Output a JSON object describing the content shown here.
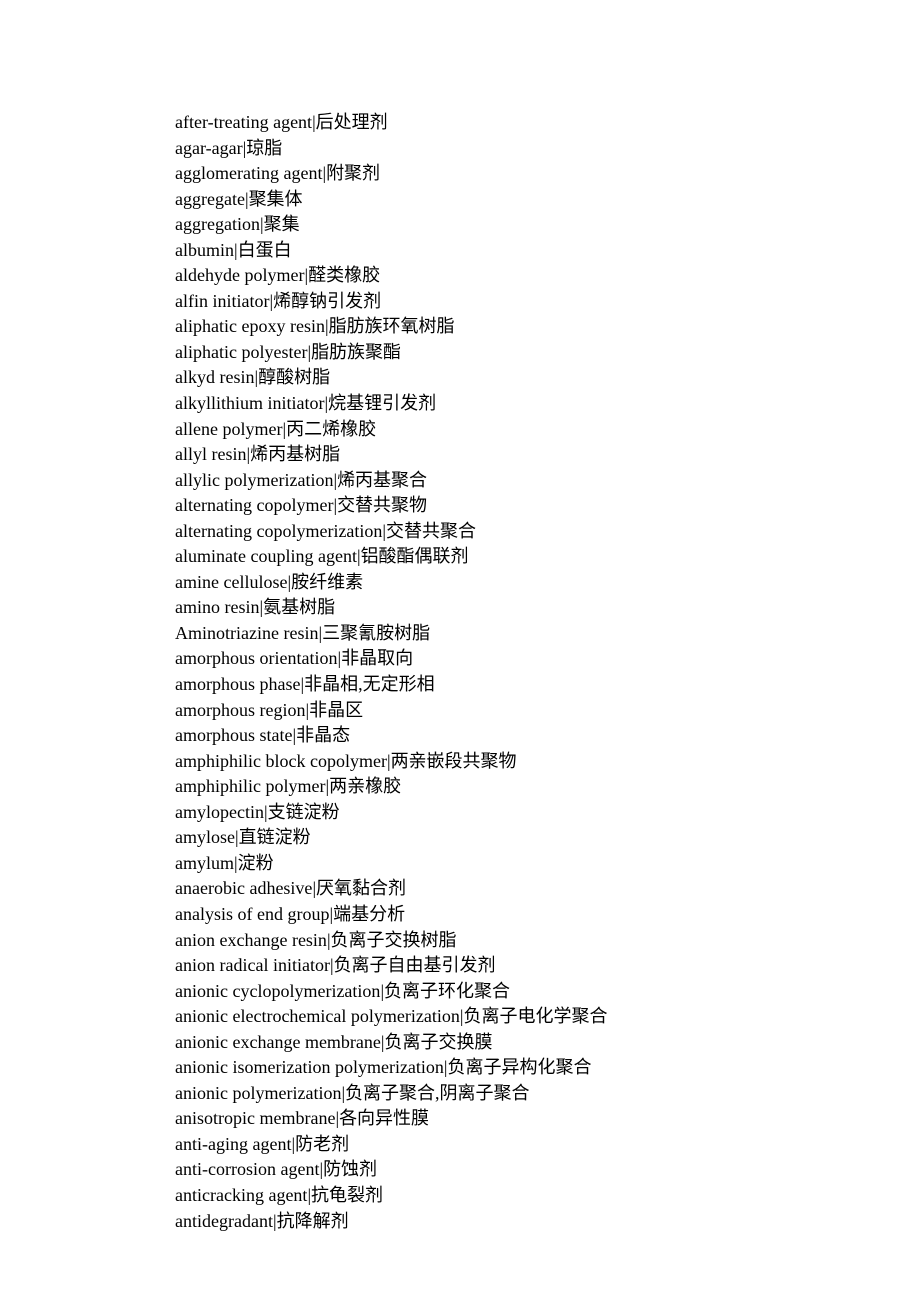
{
  "terms": [
    {
      "en": "after-treating agent",
      "zh": "后处理剂"
    },
    {
      "en": "agar-agar",
      "zh": "琼脂"
    },
    {
      "en": "agglomerating agent",
      "zh": "附聚剂"
    },
    {
      "en": "aggregate",
      "zh": "聚集体"
    },
    {
      "en": "aggregation",
      "zh": "聚集"
    },
    {
      "en": "albumin",
      "zh": "白蛋白"
    },
    {
      "en": "aldehyde polymer",
      "zh": "醛类橡胶"
    },
    {
      "en": "alfin initiator",
      "zh": "烯醇钠引发剂"
    },
    {
      "en": "aliphatic epoxy resin",
      "zh": "脂肪族环氧树脂"
    },
    {
      "en": "aliphatic polyester",
      "zh": "脂肪族聚酯"
    },
    {
      "en": "alkyd resin",
      "zh": "醇酸树脂"
    },
    {
      "en": "alkyllithium initiator",
      "zh": "烷基锂引发剂"
    },
    {
      "en": "allene polymer",
      "zh": "丙二烯橡胶"
    },
    {
      "en": "allyl resin",
      "zh": "烯丙基树脂"
    },
    {
      "en": "allylic polymerization",
      "zh": "烯丙基聚合"
    },
    {
      "en": "alternating copolymer",
      "zh": "交替共聚物"
    },
    {
      "en": "alternating copolymerization",
      "zh": "交替共聚合"
    },
    {
      "en": "aluminate coupling agent",
      "zh": "铝酸酯偶联剂"
    },
    {
      "en": "amine cellulose",
      "zh": "胺纤维素"
    },
    {
      "en": "amino resin",
      "zh": "氨基树脂"
    },
    {
      "en": "Aminotriazine resin",
      "zh": "三聚氰胺树脂"
    },
    {
      "en": "amorphous orientation",
      "zh": "非晶取向"
    },
    {
      "en": "amorphous phase",
      "zh": "非晶相,无定形相"
    },
    {
      "en": "amorphous region",
      "zh": "非晶区"
    },
    {
      "en": "amorphous state",
      "zh": "非晶态"
    },
    {
      "en": "amphiphilic block copolymer",
      "zh": "两亲嵌段共聚物"
    },
    {
      "en": "amphiphilic polymer",
      "zh": "两亲橡胶"
    },
    {
      "en": "amylopectin",
      "zh": "支链淀粉"
    },
    {
      "en": "amylose",
      "zh": "直链淀粉"
    },
    {
      "en": "amylum",
      "zh": "淀粉"
    },
    {
      "en": "anaerobic adhesive",
      "zh": "厌氧黏合剂"
    },
    {
      "en": "analysis of end group",
      "zh": "端基分析"
    },
    {
      "en": "anion exchange resin",
      "zh": "负离子交换树脂"
    },
    {
      "en": "anion radical initiator",
      "zh": "负离子自由基引发剂"
    },
    {
      "en": "anionic cyclopolymerization",
      "zh": "负离子环化聚合"
    },
    {
      "en": "anionic electrochemical polymerization",
      "zh": "负离子电化学聚合"
    },
    {
      "en": "anionic exchange membrane",
      "zh": "负离子交换膜"
    },
    {
      "en": "anionic isomerization polymerization",
      "zh": "负离子异构化聚合"
    },
    {
      "en": "anionic polymerization",
      "zh": "负离子聚合,阴离子聚合"
    },
    {
      "en": "anisotropic membrane",
      "zh": "各向异性膜"
    },
    {
      "en": "anti-aging agent",
      "zh": "防老剂"
    },
    {
      "en": "anti-corrosion agent",
      "zh": "防蚀剂"
    },
    {
      "en": "anticracking agent",
      "zh": "抗龟裂剂"
    },
    {
      "en": "antidegradant",
      "zh": "抗降解剂"
    }
  ]
}
